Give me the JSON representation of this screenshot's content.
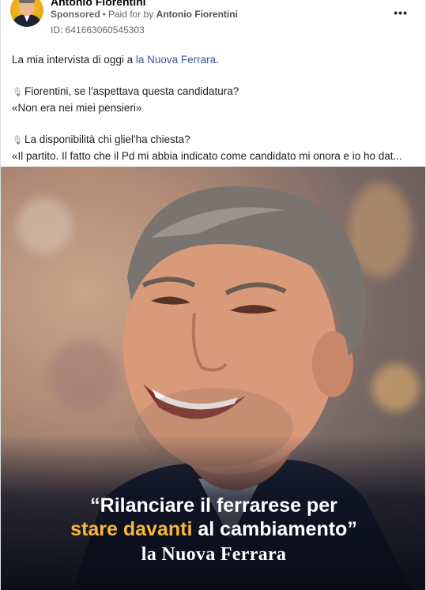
{
  "post": {
    "page_name": "Antonio Fiorentini",
    "sponsored_label": "Sponsored",
    "paid_for_prefix": "Paid for by",
    "paid_for_name": "Antonio Fiorentini",
    "ad_id": "ID: 641663060545303",
    "more_label": "•••"
  },
  "text": {
    "line1_prefix": "La mia intervista di oggi a ",
    "line1_link": "la Nuova Ferrara",
    "line1_suffix": ".",
    "q1": "Fiorentini, se l'aspettava questa candidatura?",
    "a1": "«Non era nei miei pensieri»",
    "q2": "La disponibilità chi gliel'ha chiesta?",
    "a2": "«Il partito. Il fatto che il Pd mi abbia indicato come candidato mi onora e io ho dat..."
  },
  "image": {
    "quote_line1": "“Rilanciare il ferrarese per",
    "quote_highlight": "stare davanti",
    "quote_line2_rest": " al cambiamento”",
    "brand": "la Nuova Ferrara",
    "highlight_color": "#f5b73b"
  },
  "icons": {
    "avatar": "profile-photo",
    "more": "more-options-icon",
    "mic": "microphone-icon"
  }
}
